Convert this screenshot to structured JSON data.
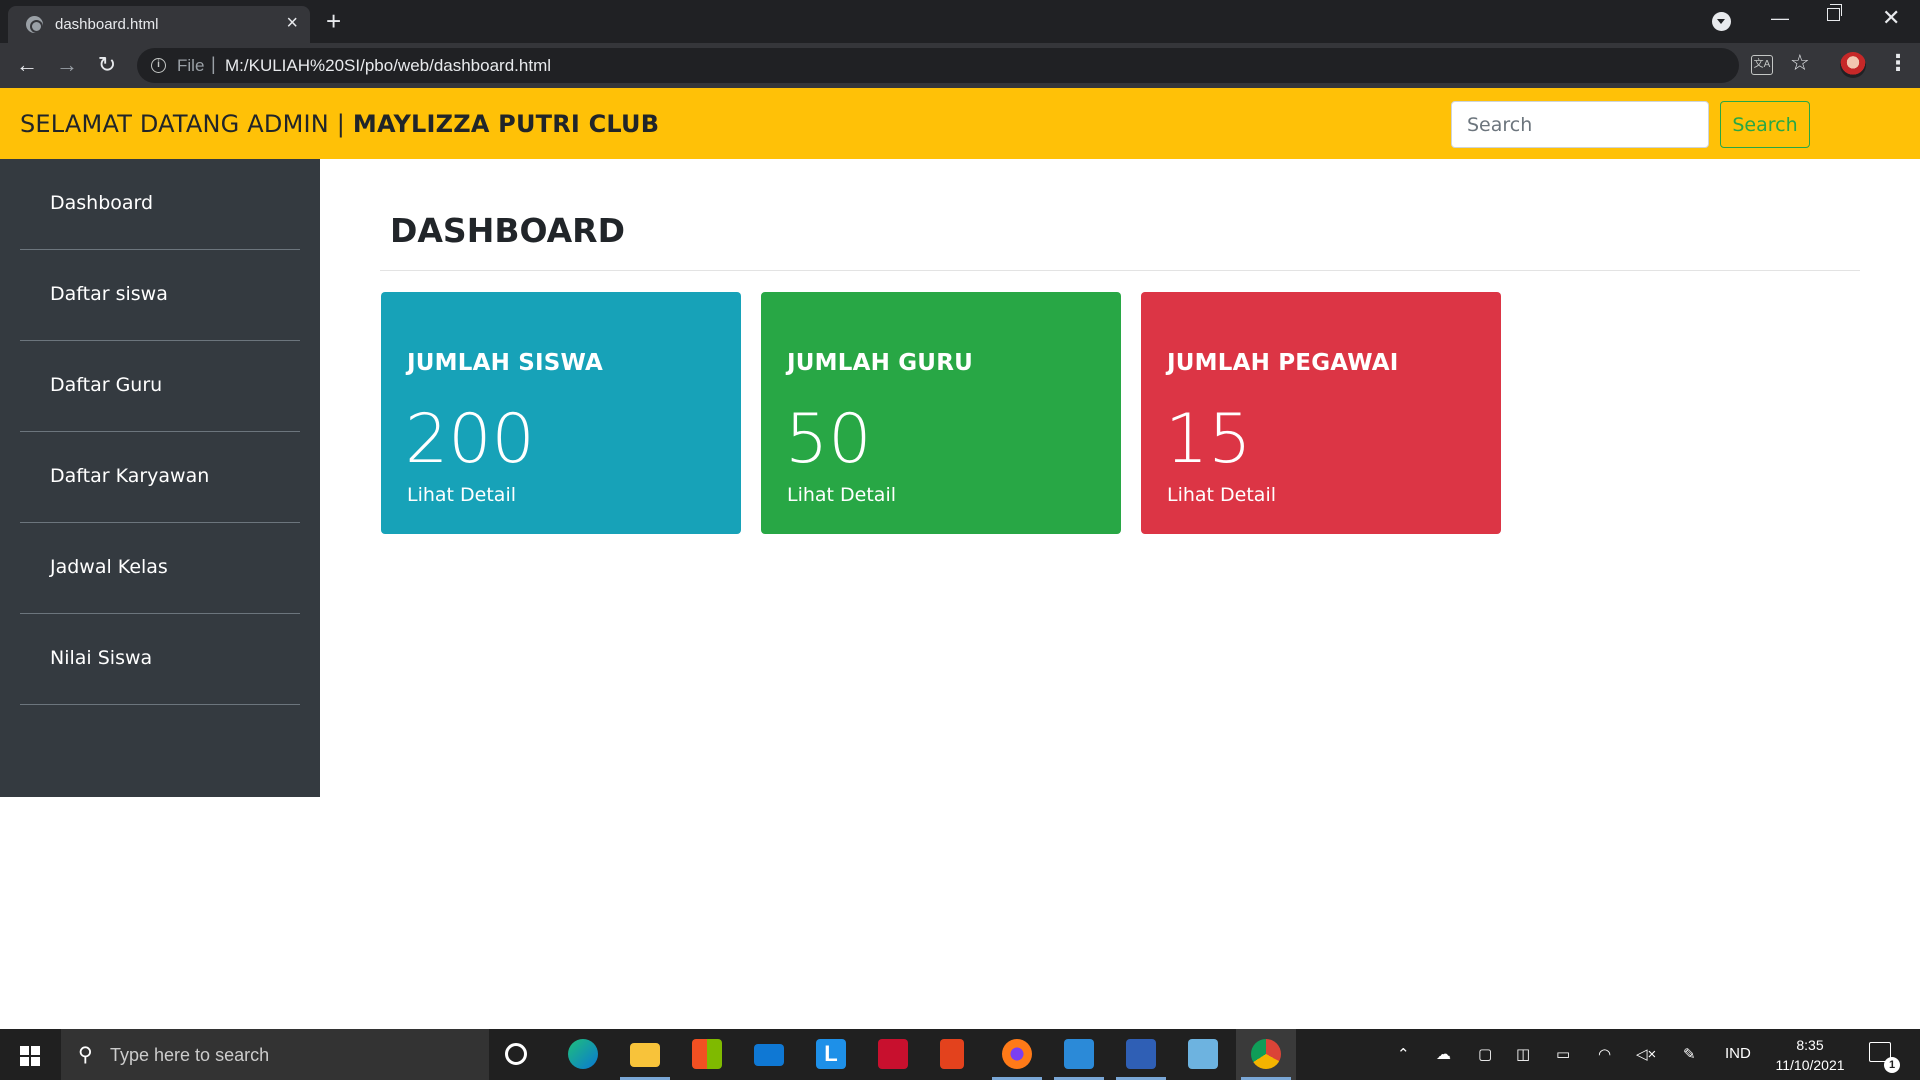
{
  "browser": {
    "tab_title": "dashboard.html",
    "tab_close": "×",
    "new_tab": "+",
    "file_label": "File",
    "url": "M:/KULIAH%20SI/pbo/web/dashboard.html"
  },
  "navbar": {
    "brand_prefix": "SELAMAT DATANG ADMIN | ",
    "brand_strong": "MAYLIZZA PUTRI CLUB",
    "search_placeholder": "Search",
    "search_button": "Search",
    "bg_color": "#ffc107"
  },
  "sidebar": {
    "items": [
      {
        "label": "Dashboard"
      },
      {
        "label": "Daftar siswa"
      },
      {
        "label": "Daftar Guru"
      },
      {
        "label": "Daftar Karyawan"
      },
      {
        "label": "Jadwal Kelas"
      },
      {
        "label": "Nilai Siswa"
      }
    ],
    "bg_color": "#343a40"
  },
  "main": {
    "title": "DASHBOARD",
    "cards": [
      {
        "label": "JUMLAH SISWA",
        "value": "200",
        "link": "Lihat Detail",
        "color": "#17a2b8"
      },
      {
        "label": "JUMLAH GURU",
        "value": "50",
        "link": "Lihat Detail",
        "color": "#28a745"
      },
      {
        "label": "JUMLAH PEGAWAI",
        "value": "15",
        "link": "Lihat Detail",
        "color": "#dc3545"
      }
    ]
  },
  "taskbar": {
    "search_placeholder": "Type here to search",
    "language": "IND",
    "time": "8:35",
    "date": "11/10/2021",
    "notification_count": "1",
    "apps": [
      "cortana-icon",
      "edge-icon",
      "file-explorer-icon",
      "store-icon",
      "mail-icon",
      "l-app-icon",
      "mcafee-icon",
      "office-icon",
      "firefox-icon",
      "vscode-icon",
      "powershell-icon",
      "notepad-icon",
      "chrome-icon"
    ]
  }
}
